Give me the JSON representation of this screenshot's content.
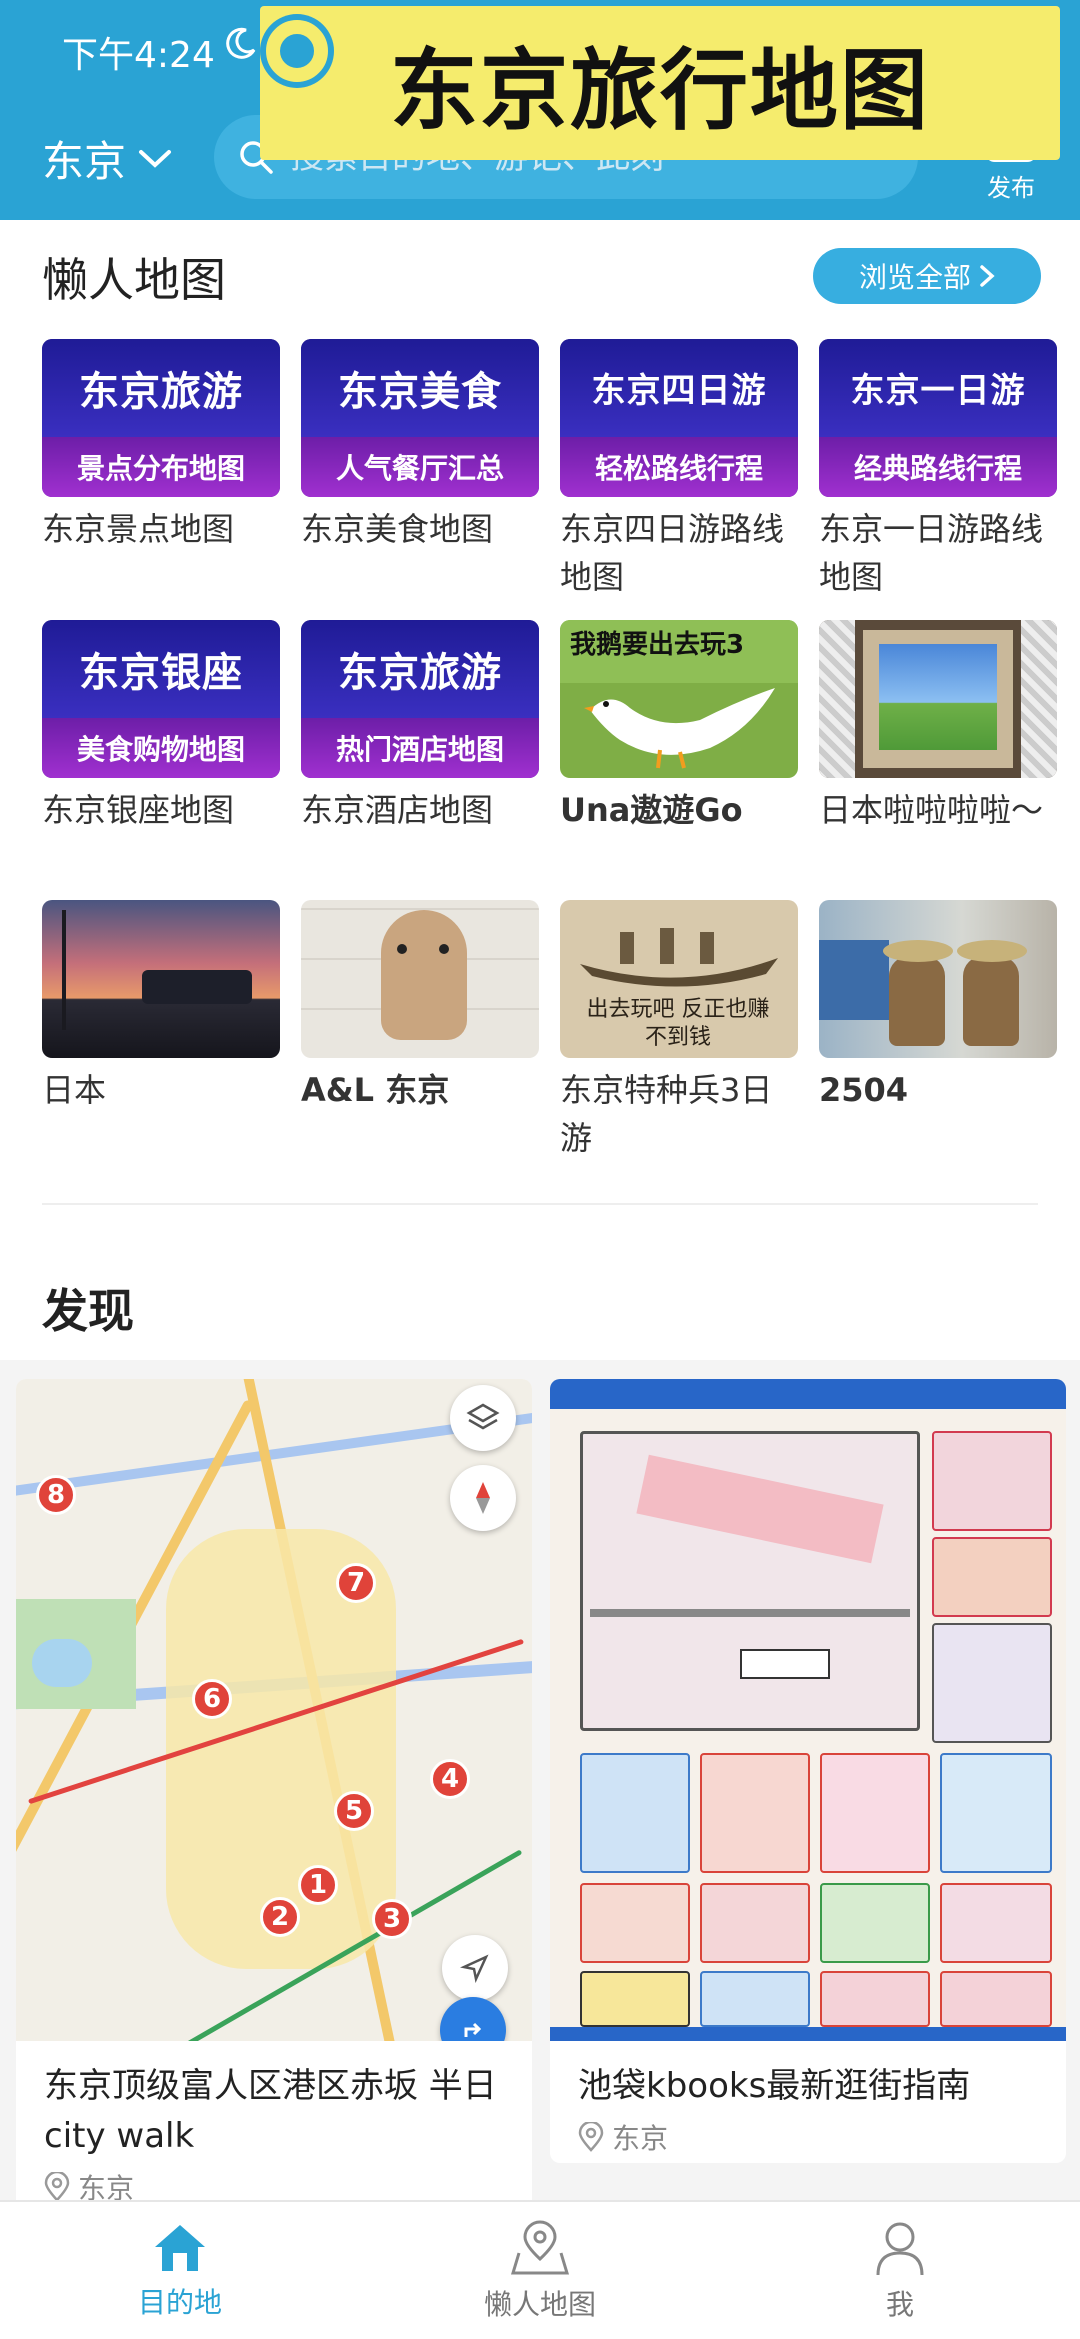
{
  "status_bar": {
    "time": "下午4:24"
  },
  "header": {
    "city": "东京",
    "search_placeholder": "搜索目的地、游记、此刻",
    "publish_label": "发布",
    "banner_title": "东京旅行地图"
  },
  "lazy_maps": {
    "section_title": "懒人地图",
    "browse_all_label": "浏览全部",
    "items": [
      {
        "label": "东京景点地图",
        "thumb_line1": "东京旅游",
        "thumb_line2": "景点分布地图"
      },
      {
        "label": "东京美食地图",
        "thumb_line1": "东京美食",
        "thumb_line2": "人气餐厅汇总"
      },
      {
        "label": "东京四日游路线地图",
        "thumb_line1": "东京四日游",
        "thumb_line2": "轻松路线行程"
      },
      {
        "label": "东京一日游路线地图",
        "thumb_line1": "东京一日游",
        "thumb_line2": "经典路线行程"
      },
      {
        "label": "东京银座地图",
        "thumb_line1": "东京银座",
        "thumb_line2": "美食购物地图"
      },
      {
        "label": "东京酒店地图",
        "thumb_line1": "东京旅游",
        "thumb_line2": "热门酒店地图"
      },
      {
        "label": "Una遨遊Go",
        "thumb_text": "我鹅要出去玩3"
      },
      {
        "label": "日本啦啦啦啦～"
      },
      {
        "label": "日本"
      },
      {
        "label": "A&L 东京"
      },
      {
        "label": "东京特种兵3日游",
        "thumb_text": "出去玩吧 反正也赚不到钱"
      },
      {
        "label": "2504"
      }
    ]
  },
  "discover": {
    "section_title": "发现",
    "cards": [
      {
        "title": "东京顶级富人区港区赤坂 半日city walk",
        "location": "东京"
      },
      {
        "title": "池袋kbooks最新逛街指南",
        "location": "东京"
      }
    ]
  },
  "tabbar": {
    "items": [
      {
        "label": "目的地",
        "icon": "home-icon",
        "active": true
      },
      {
        "label": "懒人地图",
        "icon": "map-pin-icon",
        "active": false
      },
      {
        "label": "我",
        "icon": "person-icon",
        "active": false
      }
    ]
  },
  "colors": {
    "brand": "#2aa3d4",
    "banner_yellow": "#f5ec6d",
    "pin_red": "#e0433a"
  }
}
